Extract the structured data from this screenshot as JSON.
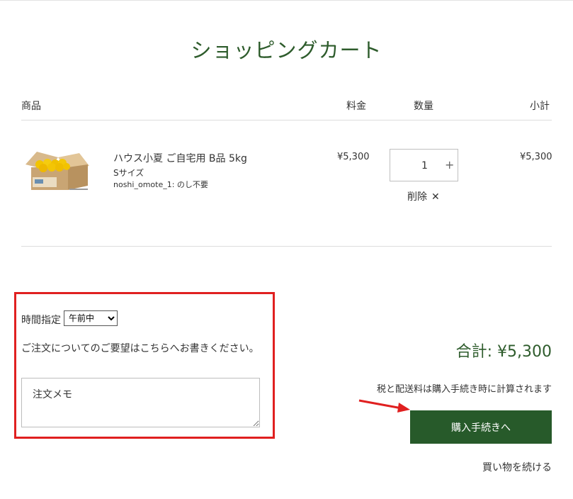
{
  "page": {
    "title": "ショッピングカート"
  },
  "table_headers": {
    "product": "商品",
    "price": "料金",
    "quantity": "数量",
    "subtotal": "小計"
  },
  "item": {
    "name": "ハウス小夏 ご自宅用 B品 5kg",
    "variant": "Sサイズ",
    "option": "noshi_omote_1: のし不要",
    "price": "¥5,300",
    "quantity": "1",
    "subtotal": "¥5,300",
    "remove_label": "削除",
    "image_icon": "boxed-yellow-citrus-image"
  },
  "order_notes": {
    "time_label": "時間指定",
    "time_selected": "午前中",
    "request_label": "ご注文についてのご要望はこちらへお書きください。",
    "memo_placeholder": "注文メモ"
  },
  "summary": {
    "total": "合計: ¥5,300",
    "tax_note": "税と配送料は購入手続き時に計算されます",
    "checkout_label": "購入手続きへ",
    "continue_label": "買い物を続ける"
  },
  "colors": {
    "brand_green": "#275a2a",
    "annotation_red": "#e02020"
  }
}
